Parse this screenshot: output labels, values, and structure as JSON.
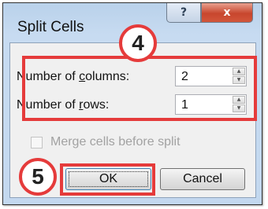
{
  "window": {
    "title": "Split Cells",
    "help_glyph": "?",
    "close_glyph": "x"
  },
  "fields": {
    "columns": {
      "label_pre": "Number of ",
      "label_key": "c",
      "label_post": "olumns:",
      "value": "2"
    },
    "rows": {
      "label_pre": "Number of ",
      "label_key": "r",
      "label_post": "ows:",
      "value": "1"
    }
  },
  "spinner": {
    "up_glyph": "▲",
    "down_glyph": "▼"
  },
  "merge_checkbox": {
    "label": "Merge cells before split",
    "checked": false,
    "enabled": false
  },
  "buttons": {
    "ok": "OK",
    "cancel": "Cancel"
  },
  "annotations": {
    "step4": "4",
    "step5": "5",
    "color": "#e53b3b"
  }
}
